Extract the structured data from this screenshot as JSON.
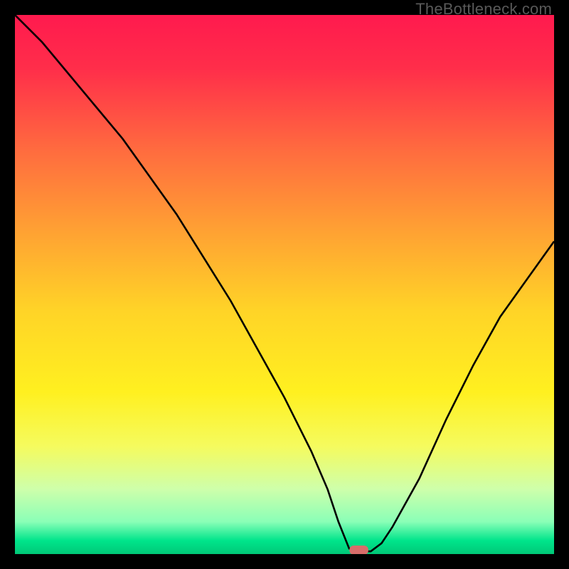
{
  "watermark": "TheBottleneck.com",
  "chart_data": {
    "type": "line",
    "title": "",
    "xlabel": "",
    "ylabel": "",
    "xlim": [
      0,
      100
    ],
    "ylim": [
      0,
      100
    ],
    "grid": false,
    "background_gradient": {
      "direction": "vertical",
      "stops": [
        {
          "pos": 0.0,
          "color": "#ff1a4e"
        },
        {
          "pos": 0.1,
          "color": "#ff2e4a"
        },
        {
          "pos": 0.25,
          "color": "#ff6b3f"
        },
        {
          "pos": 0.4,
          "color": "#ffa133"
        },
        {
          "pos": 0.55,
          "color": "#ffd427"
        },
        {
          "pos": 0.7,
          "color": "#fff020"
        },
        {
          "pos": 0.8,
          "color": "#f5fb5e"
        },
        {
          "pos": 0.88,
          "color": "#ceffab"
        },
        {
          "pos": 0.94,
          "color": "#8affb7"
        },
        {
          "pos": 0.975,
          "color": "#00e58b"
        },
        {
          "pos": 1.0,
          "color": "#00c878"
        }
      ]
    },
    "marker": {
      "shape": "pill",
      "x": 63.8,
      "y": 0.0,
      "width": 3.5,
      "color": "#d86d6a"
    },
    "series": [
      {
        "name": "bottleneck-curve",
        "color": "#000000",
        "x": [
          0,
          5,
          10,
          15,
          20,
          25,
          30,
          35,
          40,
          45,
          50,
          55,
          58,
          60,
          62,
          64,
          66,
          68,
          70,
          75,
          80,
          85,
          90,
          95,
          100
        ],
        "y": [
          100,
          95,
          89,
          83,
          77,
          70,
          63,
          55,
          47,
          38,
          29,
          19,
          12,
          6,
          1,
          0.5,
          0.5,
          2,
          5,
          14,
          25,
          35,
          44,
          51,
          58
        ]
      }
    ]
  }
}
